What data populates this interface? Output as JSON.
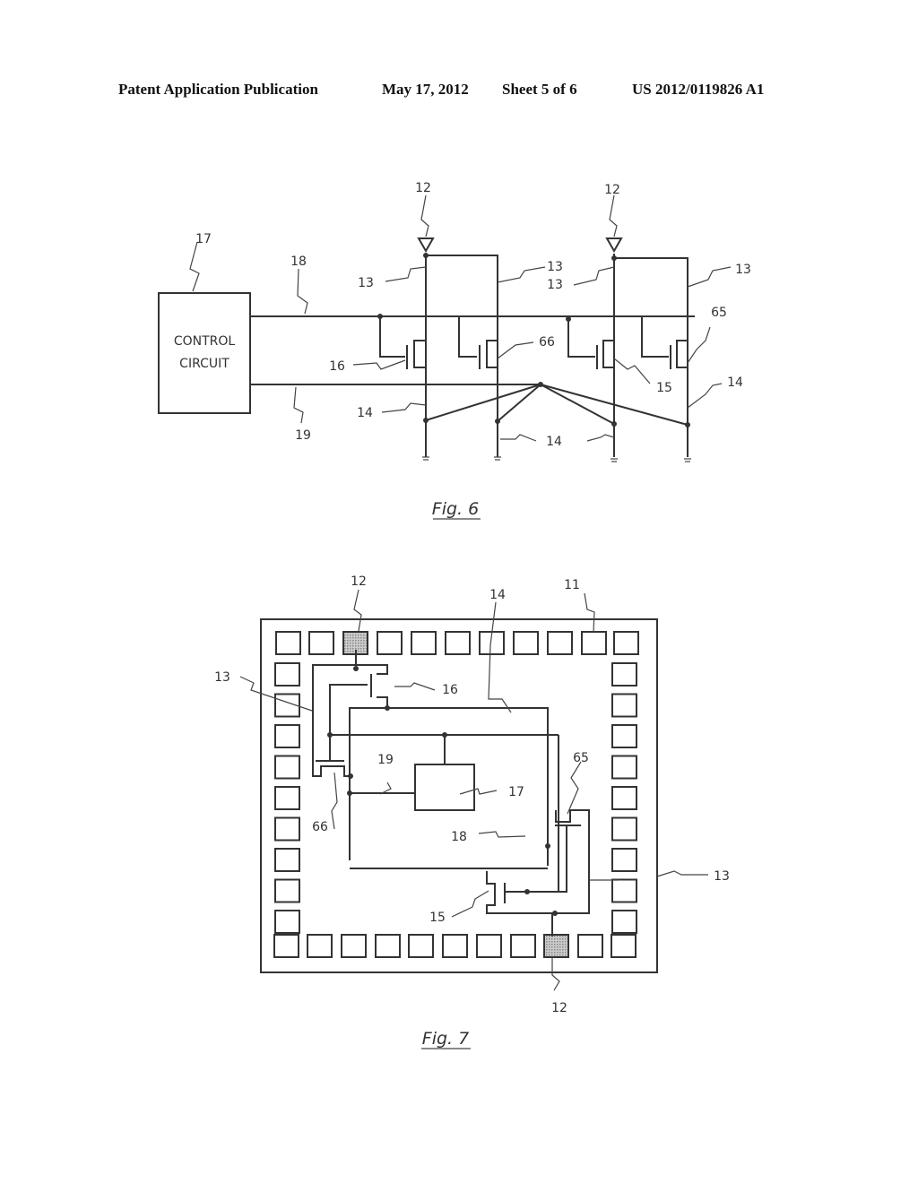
{
  "header": {
    "publication": "Patent Application Publication",
    "date": "May 17, 2012",
    "sheet": "Sheet 5 of 6",
    "number": "US 2012/0119826 A1"
  },
  "fig6": {
    "caption": "Fig. 6",
    "control_circuit_line1": "CONTROL",
    "control_circuit_line2": "CIRCUIT",
    "labels": {
      "control_circuit": "17",
      "line18": "18",
      "line19": "19",
      "terminal_a": "12",
      "terminal_b": "12",
      "wire13_a": "13",
      "wire13_b": "13",
      "wire13_c": "13",
      "wire13_d": "13",
      "transistor16": "16",
      "transistor66": "66",
      "transistor15": "15",
      "transistor65": "65",
      "wire14_a": "14",
      "wire14_b": "14",
      "wire14_c": "14"
    }
  },
  "fig7": {
    "caption": "Fig. 7",
    "labels": {
      "terminal_top": "12",
      "terminal_bottom": "12",
      "pad": "11",
      "wire14": "14",
      "wire13_left": "13",
      "wire13_right": "13",
      "transistor16": "16",
      "transistor66": "66",
      "transistor65": "65",
      "transistor15": "15",
      "line19": "19",
      "line18": "18",
      "control_circuit": "17"
    }
  }
}
